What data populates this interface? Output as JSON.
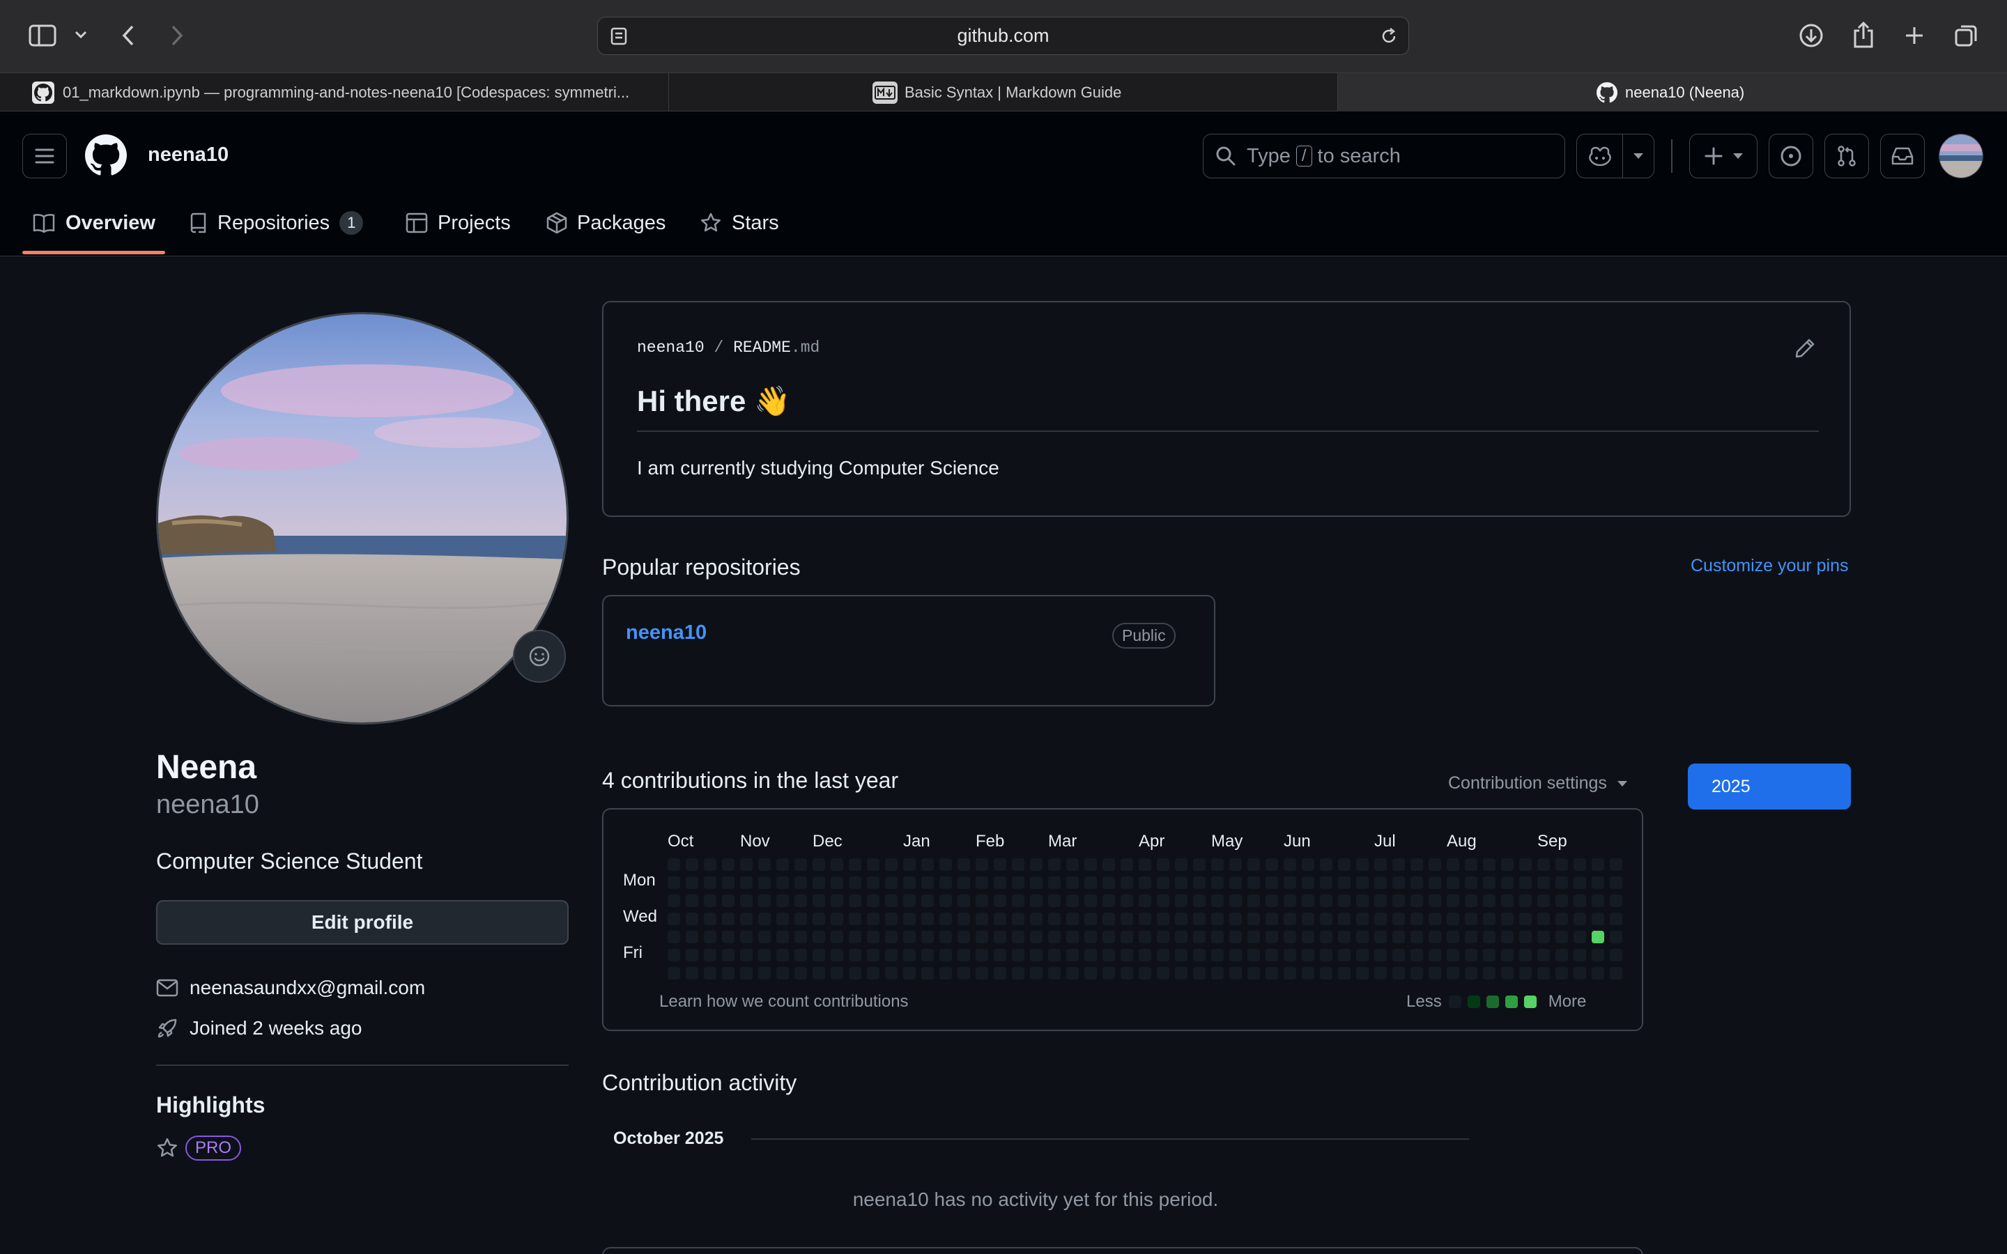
{
  "browser": {
    "url": "github.com",
    "tabs": [
      {
        "title": "01_markdown.ipynb — programming-and-notes-neena10 [Codespaces: symmetri..."
      },
      {
        "title": "Basic Syntax | Markdown Guide"
      },
      {
        "title": "neena10 (Neena)"
      }
    ]
  },
  "header": {
    "username": "neena10",
    "search_type": "Type",
    "search_key": "/",
    "search_rest": "to search"
  },
  "nav": {
    "overview": "Overview",
    "repositories": "Repositories",
    "repositories_count": "1",
    "projects": "Projects",
    "packages": "Packages",
    "stars": "Stars"
  },
  "profile": {
    "name": "Neena",
    "login": "neena10",
    "bio": "Computer Science Student",
    "edit_button": "Edit profile",
    "email": "neenasaundxx@gmail.com",
    "joined": "Joined 2 weeks ago",
    "highlights_title": "Highlights",
    "pro_badge": "PRO"
  },
  "readme": {
    "path_owner": "neena10",
    "path_sep": "/",
    "path_file": "README",
    "path_ext": ".md",
    "heading": "Hi there 👋",
    "body": "I am currently studying Computer Science"
  },
  "popular": {
    "title": "Popular repositories",
    "customize": "Customize your pins",
    "repos": [
      {
        "name": "neena10",
        "visibility": "Public"
      }
    ]
  },
  "contributions": {
    "title": "4 contributions in the last year",
    "settings": "Contribution settings",
    "year": "2025",
    "months": [
      "Oct",
      "Nov",
      "Dec",
      "Jan",
      "Feb",
      "Mar",
      "Apr",
      "May",
      "Jun",
      "Jul",
      "Aug",
      "Sep"
    ],
    "days": [
      "Mon",
      "Wed",
      "Fri"
    ],
    "learn": "Learn how we count contributions",
    "less": "Less",
    "more": "More",
    "levels": [
      "#151b23",
      "#033a16",
      "#196c2e",
      "#2ea043",
      "#56d364"
    ],
    "active_cell": {
      "week": 51,
      "day": 4,
      "level": 4
    }
  },
  "activity": {
    "title": "Contribution activity",
    "period": "October 2025",
    "empty": "neena10 has no activity yet for this period."
  }
}
